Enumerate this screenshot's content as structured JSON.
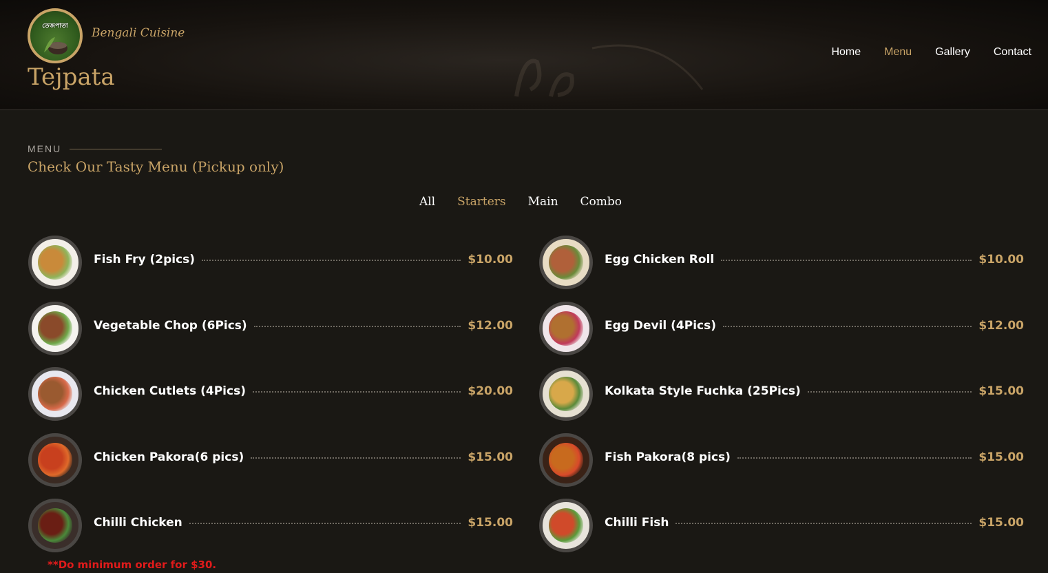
{
  "header": {
    "logo_text": "তেজপাতা",
    "tagline": "Bengali Cuisine",
    "brand_name": "Tejpata",
    "nav": [
      {
        "label": "Home",
        "active": false
      },
      {
        "label": "Menu",
        "active": true
      },
      {
        "label": "Gallery",
        "active": false
      },
      {
        "label": "Contact",
        "active": false
      }
    ]
  },
  "section": {
    "label": "MENU",
    "title": "Check Our Tasty Menu (Pickup only)"
  },
  "filters": [
    {
      "label": "All",
      "active": false
    },
    {
      "label": "Starters",
      "active": true
    },
    {
      "label": "Main",
      "active": false
    },
    {
      "label": "Combo",
      "active": false
    }
  ],
  "menu": {
    "left": [
      {
        "name": "Fish Fry (2pics)",
        "price": "$10.00",
        "image": "fish-fry",
        "colors": [
          "#f3efe8",
          "#c98a3a",
          "#8fb35a"
        ]
      },
      {
        "name": "Vegetable Chop (6Pics)",
        "price": "$12.00",
        "image": "vegetable-chop",
        "colors": [
          "#f5f3ef",
          "#8a4a2a",
          "#6fa84a"
        ]
      },
      {
        "name": "Chicken Cutlets (4Pics)",
        "price": "$20.00",
        "image": "chicken-cutlets",
        "colors": [
          "#e8e8ef",
          "#9a5a30",
          "#d86a4a"
        ]
      },
      {
        "name": "Chicken Pakora(6 pics)",
        "price": "$15.00",
        "image": "chicken-pakora",
        "colors": [
          "#3a2a22",
          "#c8401e",
          "#e06a2a"
        ]
      },
      {
        "name": "Chilli Chicken",
        "price": "$15.00",
        "image": "chilli-chicken",
        "colors": [
          "#3a2e2a",
          "#6a1e14",
          "#4a8a3a"
        ]
      }
    ],
    "right": [
      {
        "name": "Egg Chicken Roll",
        "price": "$10.00",
        "image": "egg-chicken-roll",
        "colors": [
          "#e8dcc4",
          "#b0603a",
          "#6a8a3a"
        ]
      },
      {
        "name": "Egg Devil (4Pics)",
        "price": "$12.00",
        "image": "egg-devil",
        "colors": [
          "#f0e6ea",
          "#b07030",
          "#c03a5a"
        ]
      },
      {
        "name": "Kolkata Style Fuchka (25Pics)",
        "price": "$15.00",
        "image": "kolkata-fuchka",
        "colors": [
          "#e6e0d2",
          "#d8a84a",
          "#5a8a3a"
        ]
      },
      {
        "name": "Fish Pakora(8 pics)",
        "price": "$15.00",
        "image": "fish-pakora",
        "colors": [
          "#3a2216",
          "#c86a1e",
          "#d84a2a"
        ]
      },
      {
        "name": "Chilli Fish",
        "price": "$15.00",
        "image": "chilli-fish",
        "colors": [
          "#e8e4dc",
          "#d04a2a",
          "#5a9a3a"
        ]
      }
    ]
  },
  "notice": "**Do minimum order for $30."
}
